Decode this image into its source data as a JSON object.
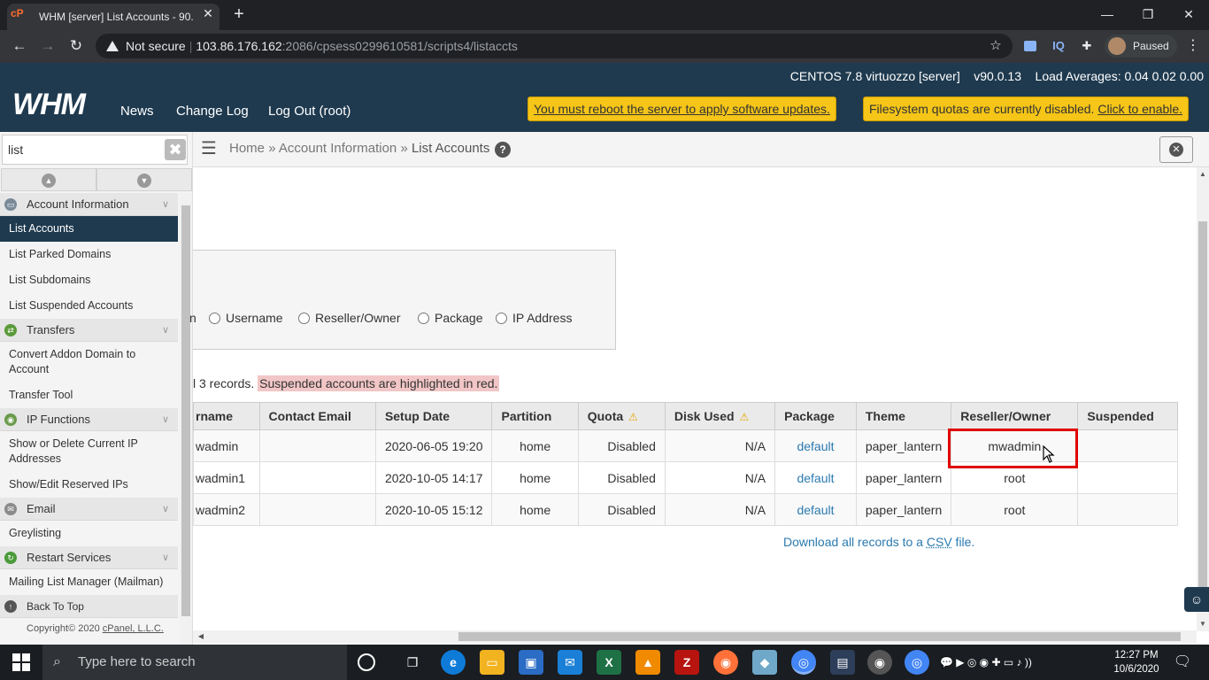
{
  "browser": {
    "tab_title": "WHM [server] List Accounts - 90.",
    "tab_icon": "cP",
    "close_glyph": "✕",
    "new_tab_glyph": "+",
    "window_buttons": [
      "—",
      "❐",
      "✕"
    ],
    "nav_glyphs": [
      "←",
      "→",
      "↻"
    ],
    "security_label": "Not secure",
    "url_host": "103.86.176.162",
    "url_rest": ":2086/cpsess0299610581/scripts4/listaccts",
    "url_sep": "|",
    "star_glyph": "☆",
    "ext_iq": "IQ",
    "profile_status": "Paused",
    "menu_glyph": "⋮",
    "colors": {
      "tabbar": "#202124",
      "toolbar": "#35363a"
    }
  },
  "whm": {
    "logo": "WHM",
    "server_info": "CENTOS 7.8 virtuozzo [server]    v90.0.13    Load Averages: 0.04 0.02 0.00",
    "nav": [
      "News",
      "Change Log",
      "Log Out (root)"
    ],
    "notice_reboot": "You must reboot the server to apply software updates.",
    "notice_quota_text": "Filesystem quotas are currently disabled.",
    "notice_quota_link": "Click to enable.",
    "colors": {
      "header": "#1f3a4f",
      "notice": "#f5c518",
      "link": "#2a7ab0"
    }
  },
  "sidebar": {
    "search_value": "list",
    "clear_glyph": "✖",
    "up_glyph": "▲",
    "down_glyph": "▼",
    "categories": [
      {
        "label": "Account Information",
        "icon": "id-card-icon",
        "items": [
          "List Accounts",
          "List Parked Domains",
          "List Subdomains",
          "List Suspended Accounts"
        ]
      },
      {
        "label": "Transfers",
        "icon": "transfer-icon",
        "items": [
          "Convert Addon Domain to Account",
          "Transfer Tool"
        ]
      },
      {
        "label": "IP Functions",
        "icon": "ip-icon",
        "items": [
          "Show or Delete Current IP Addresses",
          "Show/Edit Reserved IPs"
        ]
      },
      {
        "label": "Email",
        "icon": "email-icon",
        "items": [
          "Greylisting"
        ]
      },
      {
        "label": "Restart Services",
        "icon": "restart-icon",
        "items": [
          "Mailing List Manager (Mailman)"
        ]
      }
    ],
    "back_to_top": "Back To Top",
    "copyright_prefix": "Copyright© 2020 ",
    "copyright_link": "cPanel, L.L.C."
  },
  "breadcrumb": {
    "home": "Home",
    "section": "Account Information",
    "current": "List Accounts",
    "sep": "»",
    "help": "?"
  },
  "search": {
    "partial_option": "n",
    "options": [
      "Username",
      "Reseller/Owner",
      "Package",
      "IP Address"
    ]
  },
  "records": {
    "prefix": "l 3 records.",
    "suspended_note": "Suspended accounts are highlighted in red."
  },
  "table": {
    "headers": [
      "rname",
      "Contact Email",
      "Setup Date",
      "Partition",
      "Quota",
      "Disk Used",
      "Package",
      "Theme",
      "Reseller/Owner",
      "Suspended"
    ],
    "warn_glyph": "⚠",
    "rows": [
      {
        "user": "wadmin",
        "email": "",
        "date": "2020-06-05 19:20",
        "partition": "home",
        "quota": "Disabled",
        "disk": "N/A",
        "package": "default",
        "theme": "paper_lantern",
        "owner": "mwadmin",
        "suspended": ""
      },
      {
        "user": "wadmin1",
        "email": "",
        "date": "2020-10-05 14:17",
        "partition": "home",
        "quota": "Disabled",
        "disk": "N/A",
        "package": "default",
        "theme": "paper_lantern",
        "owner": "root",
        "suspended": ""
      },
      {
        "user": "wadmin2",
        "email": "",
        "date": "2020-10-05 15:12",
        "partition": "home",
        "quota": "Disabled",
        "disk": "N/A",
        "package": "default",
        "theme": "paper_lantern",
        "owner": "root",
        "suspended": ""
      }
    ]
  },
  "download": {
    "prefix": "Download all records to a ",
    "csv": "CSV",
    "suffix": " file."
  },
  "taskbar": {
    "search_placeholder": "Type here to search",
    "search_glyph": "⌕",
    "time": "12:27 PM",
    "date": "10/6/2020",
    "notif_glyph": "🗨"
  },
  "misc": {
    "chat_glyph": "☺",
    "menu_glyph": "☰",
    "close_glyph": "✕",
    "scroll_left": "◀",
    "scroll_up": "▲",
    "scroll_down": "▼"
  }
}
